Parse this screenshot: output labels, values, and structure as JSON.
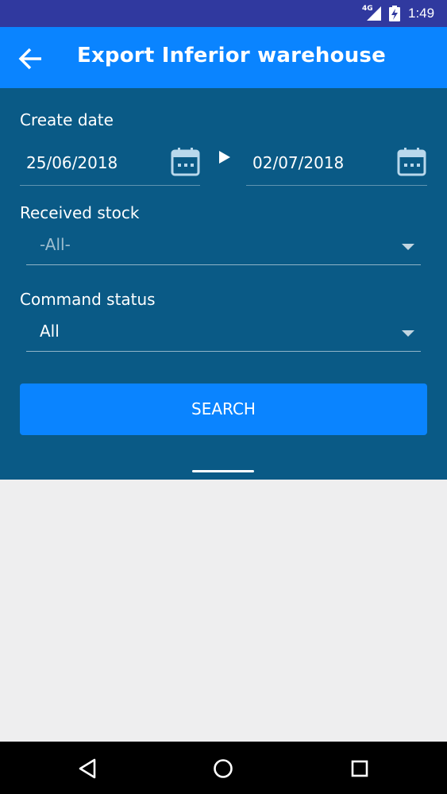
{
  "status_bar": {
    "network": "4G",
    "time": "1:49"
  },
  "app_bar": {
    "title": "Export Inferior warehouse",
    "back_icon": "arrow-left-icon"
  },
  "filters": {
    "create_date_label": "Create date",
    "date_from": "25/06/2018",
    "date_to": "02/07/2018",
    "received_stock_label": "Received stock",
    "received_stock_value": "-All-",
    "command_status_label": "Command status",
    "command_status_value": "All",
    "search_label": "SEARCH"
  },
  "nav_bar": {
    "icons": [
      "back-triangle-icon",
      "home-circle-icon",
      "recents-square-icon"
    ]
  },
  "colors": {
    "status_bar": "#30399F",
    "app_bar": "#0A84FF",
    "panel": "#0A5A86",
    "content_bg": "#EEEEEF"
  }
}
